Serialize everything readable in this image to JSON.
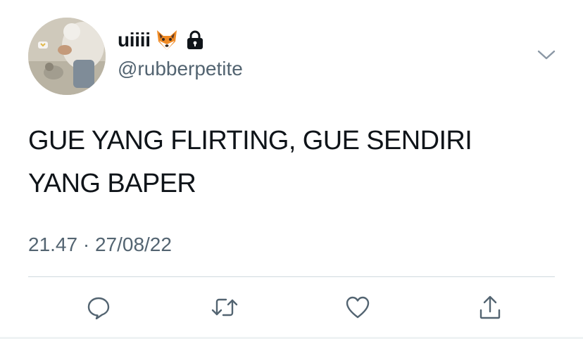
{
  "tweet": {
    "display_name": "uiiii",
    "name_emoji_icon": "fox-face-icon",
    "protected_icon": "lock-icon",
    "handle": "@rubberpetite",
    "text_line1": "GUE YANG FLIRTING, GUE SENDIRI",
    "text_line2": "YANG BAPER",
    "timestamp": "21.47 · 27/08/22"
  },
  "actions": [
    {
      "icon": "reply-icon"
    },
    {
      "icon": "retweet-icon"
    },
    {
      "icon": "like-icon"
    },
    {
      "icon": "share-icon"
    }
  ],
  "menu": {
    "icon": "chevron-down-icon"
  },
  "colors": {
    "text": "#0f1419",
    "secondary": "#536471",
    "divider": "#cfd9de"
  }
}
